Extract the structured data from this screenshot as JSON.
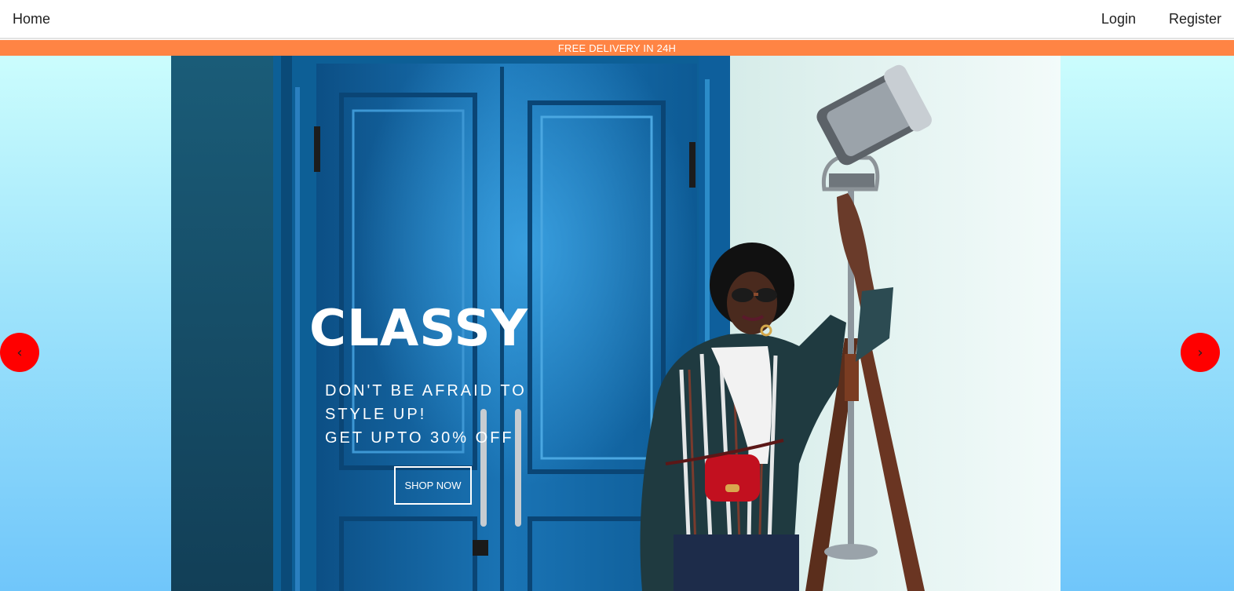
{
  "navbar": {
    "home_label": "Home",
    "login_label": "Login",
    "register_label": "Register"
  },
  "announcement": {
    "text": "FREE DELIVERY IN 24H",
    "background_color": "#ff8444"
  },
  "slider": {
    "prev_icon": "chevron-left-icon",
    "prev_glyph": "‹",
    "next_icon": "chevron-right-icon",
    "next_glyph": "›",
    "arrow_color": "#ff0000",
    "slide": {
      "title": "CLASSY",
      "description_lines": [
        "DON'T BE AFRAID TO",
        "STYLE UP!",
        "GET UPTO 30% OFF"
      ],
      "button_label": "SHOP NOW"
    }
  },
  "colors": {
    "hero_gradient_top": "#cbfdfd",
    "hero_gradient_bottom": "#70c6fa"
  }
}
